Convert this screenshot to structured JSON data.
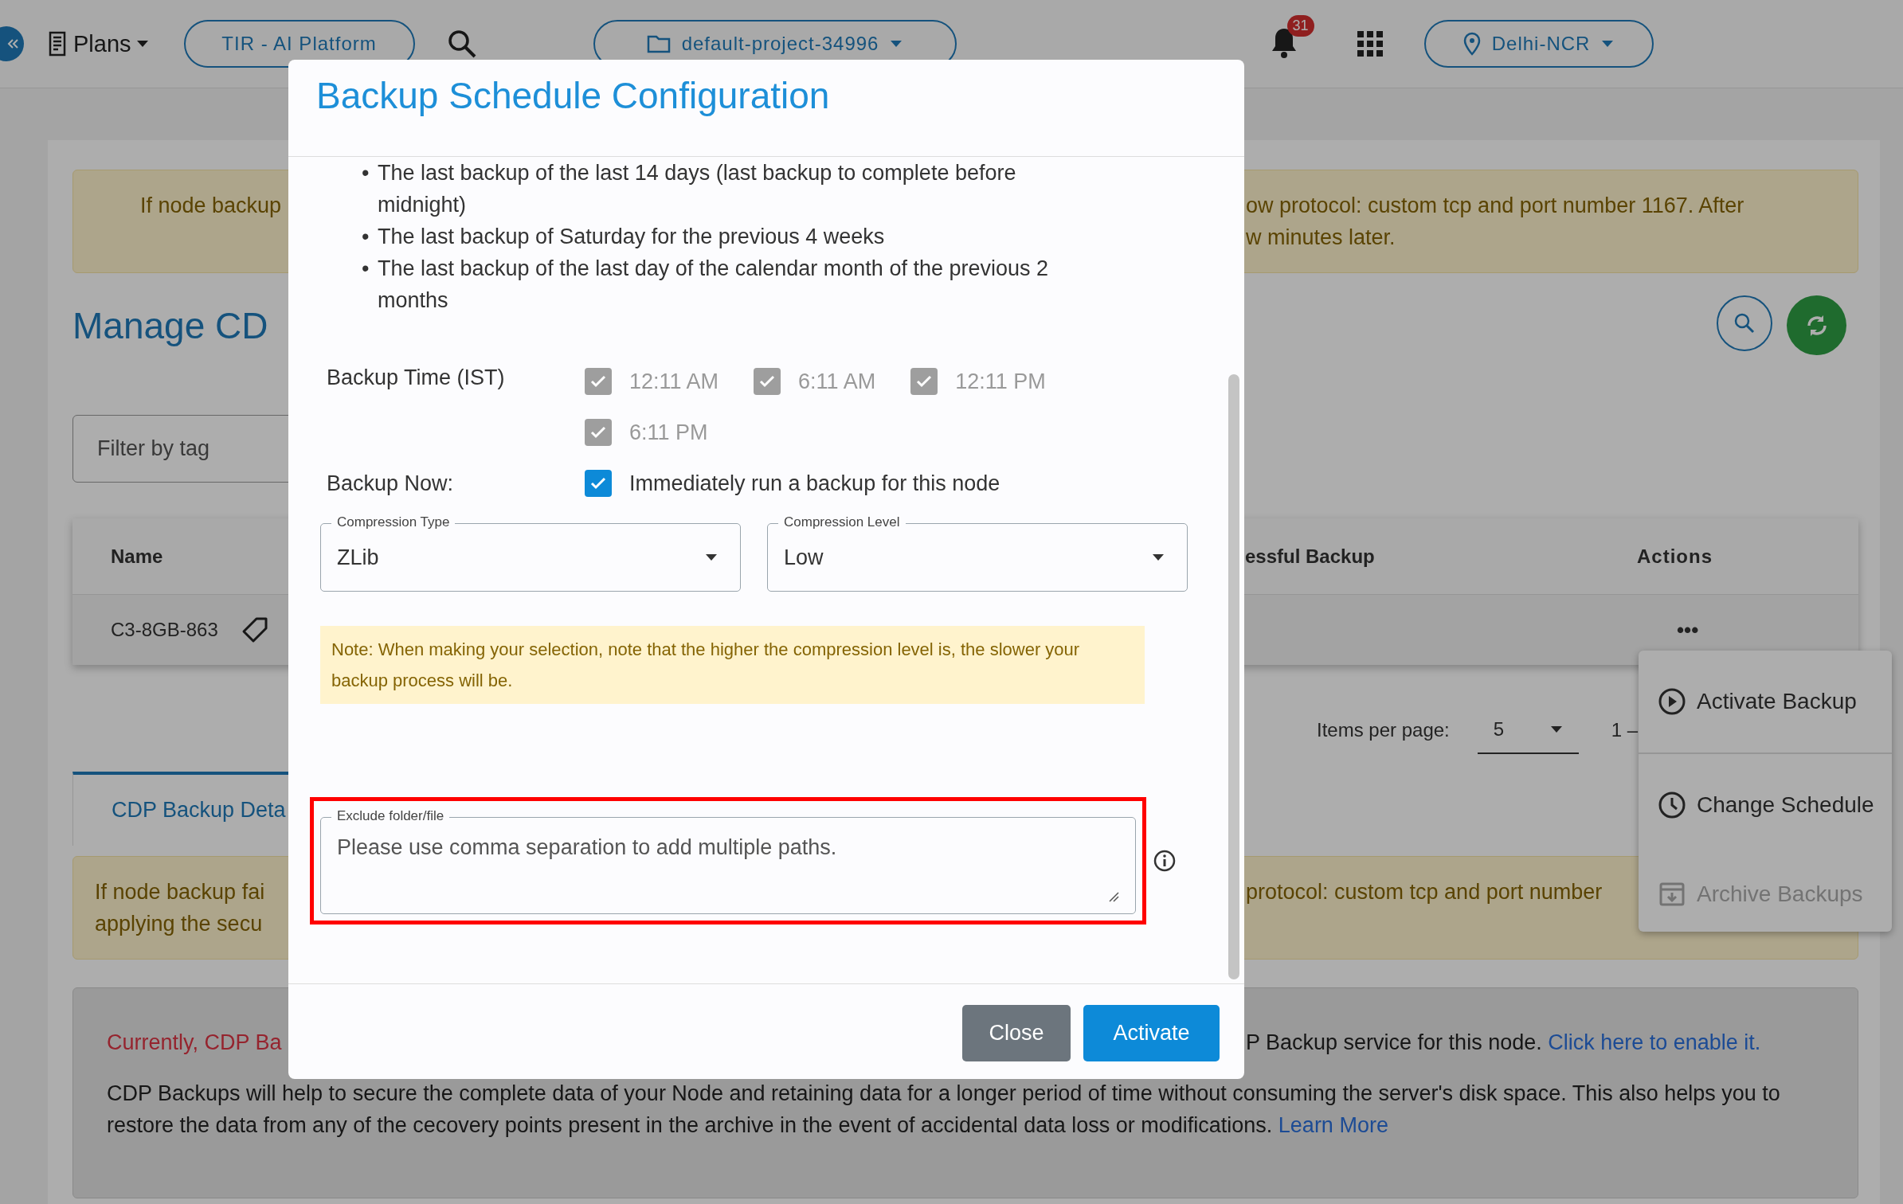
{
  "topbar": {
    "plans": "Plans",
    "platform": "TIR - AI Platform",
    "project": "default-project-34996",
    "notifications": "31",
    "region": "Delhi-NCR"
  },
  "alert_top": {
    "left": "If node backup",
    "right_lines": [
      "ow protocol: custom tcp and port number 1167. After",
      "w minutes later."
    ]
  },
  "page_title": "Manage CD",
  "filter": {
    "placeholder": "Filter by tag"
  },
  "table": {
    "columns": [
      "Name",
      "essful Backup",
      "Actions"
    ],
    "rows": [
      {
        "name": "C3-8GB-863",
        "actions": "•••"
      }
    ]
  },
  "pagination": {
    "label": "Items per page:",
    "page_size": "5",
    "range": "1 –"
  },
  "actions_menu": [
    {
      "label": "Activate Backup",
      "kind": "play",
      "disabled": false
    },
    {
      "label": "Change Schedule",
      "kind": "clock",
      "disabled": false
    },
    {
      "label": "Archive Backups",
      "kind": "archive",
      "disabled": true
    }
  ],
  "tabs": [
    {
      "label": "CDP Backup Deta",
      "selected": true
    }
  ],
  "alert_bottom": {
    "left_lines": [
      "If node backup fai",
      "applying the secu"
    ],
    "right": "protocol: custom tcp and port number"
  },
  "info": {
    "status_left": "Currently, CDP Ba",
    "status_right": "P Backup service for this node.",
    "enable_link": "Click here to enable it.",
    "description": "CDP Backups will help to secure the complete data of your Node and retaining data for a longer period of time without consuming the server's disk space. This also helps you to restore the data from any of the cecovery points present in the archive in the event of accidental data loss or modifications.",
    "learn_more": "Learn More"
  },
  "dialog": {
    "title": "Backup Schedule Configuration",
    "retention": [
      {
        "bullet": "•",
        "text": "The last backup of the last 14 days (last backup to complete before midnight)"
      },
      {
        "bullet": "•",
        "text": "The last backup of Saturday for the previous 4 weeks"
      },
      {
        "bullet": "•",
        "text": "The last backup of the last day of the calendar month of the previous 2 months"
      }
    ],
    "backup_time_label": "Backup Time (IST)",
    "times": [
      {
        "label": "12:11 AM",
        "checked": true,
        "disabled": true
      },
      {
        "label": "6:11 AM",
        "checked": true,
        "disabled": true
      },
      {
        "label": "12:11 PM",
        "checked": true,
        "disabled": true
      },
      {
        "label": "6:11 PM",
        "checked": true,
        "disabled": true
      }
    ],
    "backup_now_label": "Backup Now:",
    "backup_now": {
      "label": "Immediately run a backup for this node",
      "checked": true
    },
    "compression_type": {
      "label": "Compression Type",
      "value": "ZLib"
    },
    "compression_level": {
      "label": "Compression Level",
      "value": "Low"
    },
    "note": "Note: When making your selection, note that the higher the compression level is, the slower your backup process will be.",
    "exclude": {
      "label": "Exclude folder/file",
      "placeholder": "Please use comma separation to add multiple paths.",
      "highlighted": true
    },
    "buttons": [
      {
        "label": "Close",
        "kind": "secondary"
      },
      {
        "label": "Activate",
        "kind": "primary"
      }
    ]
  }
}
